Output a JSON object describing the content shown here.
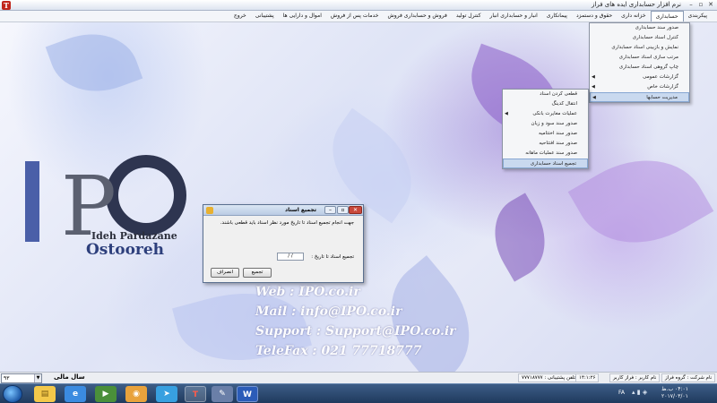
{
  "window": {
    "title": "نرم افزار حسابداری ایده های فراز"
  },
  "menubar": {
    "items": [
      "پیکربندی",
      "حسابداری",
      "خزانه داری",
      "حقوق و دستمزد",
      "پیمانکاری",
      "انبار و حسابداری انبار",
      "کنترل تولید",
      "فروش و حسابداری فروش",
      "خدمات پس از فروش",
      "اموال و دارایی ها",
      "پشتیبانی",
      "خروج"
    ],
    "active_index": 1
  },
  "accounting_menu": {
    "items": [
      {
        "label": "صدور سند حسابداری",
        "submenu": false,
        "highlight": false
      },
      {
        "label": "کنترل اسناد حسابداری",
        "submenu": false,
        "highlight": false
      },
      {
        "label": "نمایش و بازبینی اسناد حسابداری",
        "submenu": false,
        "highlight": false
      },
      {
        "label": "مرتب سازی اسناد حسابداری",
        "submenu": false,
        "highlight": false
      },
      {
        "label": "چاپ گروهی اسناد حسابداری",
        "submenu": false,
        "highlight": false
      },
      {
        "label": "گزارشات عمومی",
        "submenu": true,
        "highlight": false
      },
      {
        "label": "گزارشات خاص",
        "submenu": true,
        "highlight": false
      },
      {
        "label": "مدیریت حسابها",
        "submenu": true,
        "highlight": true
      }
    ]
  },
  "accounts_submenu": {
    "items": [
      {
        "label": "قطعی کردن اسناد",
        "submenu": false,
        "highlight": false
      },
      {
        "label": "انتقال کدینگ",
        "submenu": false,
        "highlight": false
      },
      {
        "label": "عملیات مغایرت بانکی",
        "submenu": true,
        "highlight": false
      },
      {
        "label": "صدور سند سود و زیان",
        "submenu": false,
        "highlight": false
      },
      {
        "label": "صدور سند اختتامیه",
        "submenu": false,
        "highlight": false
      },
      {
        "label": "صدور سند افتتاحیه",
        "submenu": false,
        "highlight": false
      },
      {
        "label": "صدور سند عملیات ماهانه",
        "submenu": false,
        "highlight": false
      },
      {
        "label": "تجمیع اسناد حسابداری",
        "submenu": false,
        "highlight": true
      }
    ]
  },
  "logo": {
    "letters": "IPO",
    "line1": "Ideh Pardazane",
    "line2": "Ostooreh"
  },
  "contact": {
    "web": "Web : IPO.co.ir",
    "mail": "Mail : info@IPO.co.ir",
    "support": "Support : Support@IPO.co.ir",
    "telefax": "TeleFax : 021 77718777"
  },
  "dialog": {
    "title": "تجمیع اسناد",
    "message": "جهت انجام تجمیع اسناد تا تاریخ مورد نظر اسناد باید قطعی باشند.",
    "date_label": "تجمیع اسناد تا تاریخ :",
    "date_value": "/ /",
    "ok_label": "تجمیع",
    "cancel_label": "انصراف"
  },
  "statusbar": {
    "year_value": "۹۳",
    "year_label": "سال مالی",
    "support_phone": "تلفن پشتیبانی : ۷۷۷۱۸۷۷۷",
    "time": "۱۴:۱:۲۶",
    "username": "نام کاربر : فراز کاربر",
    "company": "نام شرکت : گروه فراز"
  },
  "taskbar": {
    "language": "FA",
    "clock_time": "۰۴:۰۱ ب.ظ",
    "clock_date": "۲۰۱۷/۰۳/۰۱"
  }
}
